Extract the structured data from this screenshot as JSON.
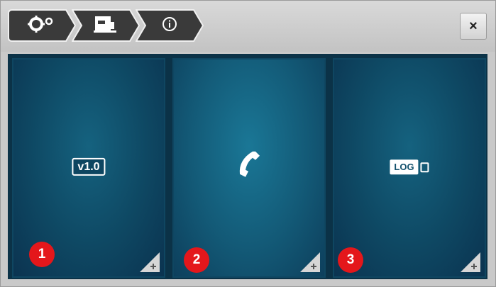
{
  "nav": {
    "crumbs": [
      {
        "icon": "settings-gear-icon"
      },
      {
        "icon": "sewing-machine-icon"
      },
      {
        "icon": "info-icon"
      }
    ],
    "close_label": "×"
  },
  "tiles": [
    {
      "icon": "version-icon",
      "label": "v1.0",
      "corner_icon": "expand-corner-icon",
      "callout": "1"
    },
    {
      "icon": "phone-icon",
      "label": "",
      "corner_icon": "expand-corner-icon",
      "callout": "2"
    },
    {
      "icon": "log-usb-icon",
      "label": "LOG",
      "corner_icon": "expand-corner-icon",
      "callout": "3"
    }
  ],
  "colors": {
    "accent_red": "#e4171b",
    "crumb_fill": "#3a3a3a",
    "panel_bg": "#0b3247",
    "tile_center": "#1a7796"
  }
}
